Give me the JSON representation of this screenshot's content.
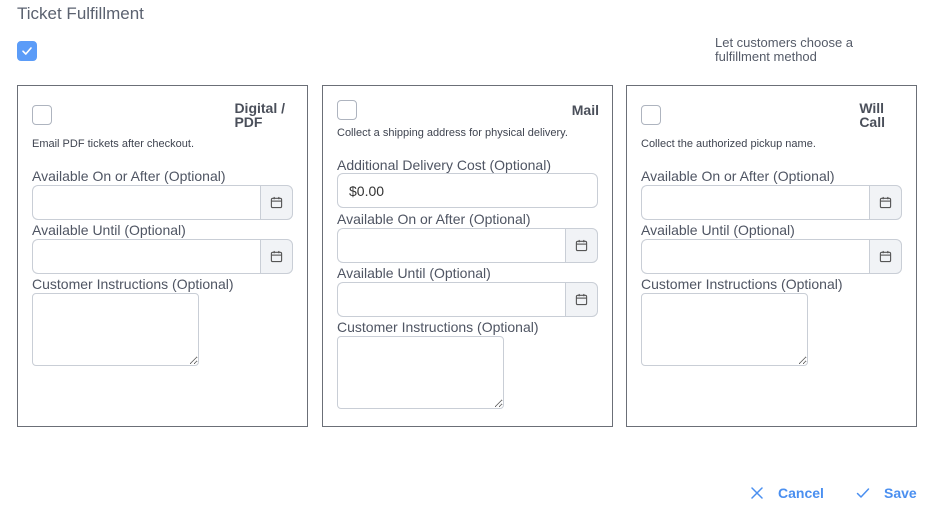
{
  "page": {
    "title": "Ticket Fulfillment"
  },
  "master": {
    "checked": true,
    "label": "Let customers choose a fulfillment method"
  },
  "panels": {
    "digital": {
      "title_line1": "Digital /",
      "title_line2": "PDF",
      "description": "Email PDF tickets after checkout.",
      "available_after_label": "Available On or After (Optional)",
      "available_until_label": "Available Until (Optional)",
      "instructions_label": "Customer Instructions (Optional)"
    },
    "mail": {
      "title": "Mail",
      "description": "Collect a shipping address for physical delivery.",
      "delivery_cost_label": "Additional Delivery Cost (Optional)",
      "delivery_cost_value": "$0.00",
      "available_after_label": "Available On or After (Optional)",
      "available_until_label": "Available Until (Optional)",
      "instructions_label": "Customer Instructions (Optional)"
    },
    "willcall": {
      "title_line1": "Will",
      "title_line2": "Call",
      "description": "Collect the authorized pickup name.",
      "available_after_label": "Available On or After (Optional)",
      "available_until_label": "Available Until (Optional)",
      "instructions_label": "Customer Instructions (Optional)"
    }
  },
  "actions": {
    "cancel_label": "Cancel",
    "save_label": "Save"
  },
  "colors": {
    "accent": "#4a8ff0",
    "checkbox_checked": "#5b9cf8"
  },
  "icons": {
    "calendar": "calendar-icon",
    "check": "checkmark-icon",
    "close": "close-icon"
  }
}
